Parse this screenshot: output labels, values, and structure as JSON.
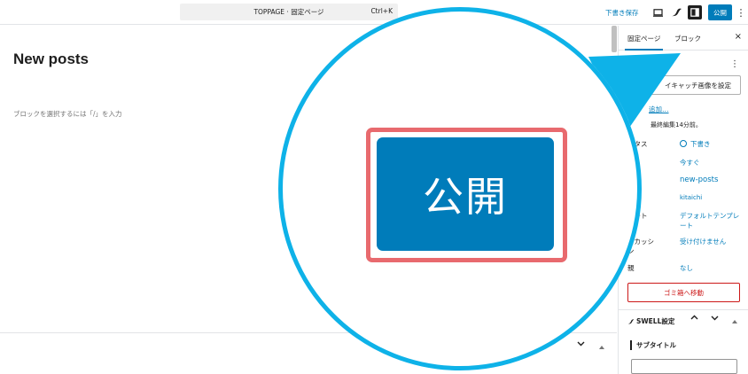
{
  "topbar": {
    "command_title": "TOPPAGE · 固定ページ",
    "command_shortcut": "Ctrl+K",
    "save_draft": "下書き保存",
    "publish": "公開",
    "more": "⋮"
  },
  "editor": {
    "post_title": "New posts",
    "block_hint": "ブロックを選択するには「/」を入力"
  },
  "sidebar": {
    "tabs": [
      "固定ページ",
      "ブロック"
    ],
    "close": "×",
    "more": "⋮",
    "eyecatch_button": "イキャッチ画像を設定",
    "add_link": "追加…",
    "last_edited": "最終編集14分前。",
    "rows": [
      {
        "label": "ータス",
        "value": "下書き"
      },
      {
        "label": "",
        "value": "今すぐ"
      },
      {
        "label": "グ",
        "value": "new-posts"
      },
      {
        "label": "",
        "value": "kitaichi"
      },
      {
        "label": "レート",
        "value": "デフォルトテンプレート"
      },
      {
        "label": "スカッシ",
        "value": "受け付けません"
      },
      {
        "label": "",
        "value": "ン"
      },
      {
        "label": "親",
        "value": "なし"
      }
    ],
    "trash_button": "ゴミ箱へ移動",
    "swell_settings": "SWELL設定",
    "subtitle_label": "サブタイトル",
    "subtitle_value": ""
  },
  "zoom": {
    "publish_label": "公開"
  },
  "colors": {
    "accent": "#007cba",
    "highlight_ring": "#0eb2e8",
    "highlight_box": "#e86a6e",
    "danger": "#cc1818"
  }
}
